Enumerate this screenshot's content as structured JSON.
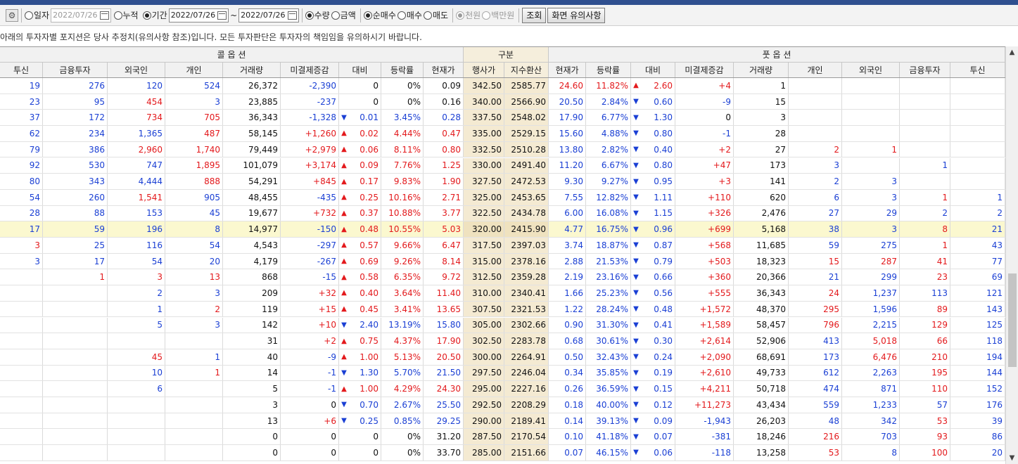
{
  "toolbar": {
    "gear_icon": "gear-icon",
    "daily_label": "일자",
    "daily_date": "2022/07/26",
    "cumulative_label": "누적",
    "period_label": "기간",
    "period_from": "2022/07/26",
    "period_to": "2022/07/26",
    "tilde": "~",
    "quantity_label": "수량",
    "amount_label": "금액",
    "net_buy_label": "순매수",
    "buy_label": "매수",
    "sell_label": "매도",
    "thousand_won_label": "천원",
    "million_won_label": "백만원",
    "query_button": "조회",
    "notes_button": "화면 유의사항"
  },
  "notice": "아래의 투자자별 포지션은 당사 추정치(유의사항 참조)입니다. 모든 투자판단은 투자자의 책임임을 유의하시기 바랍니다.",
  "header_groups": {
    "call": "콜 옵 션",
    "gubun": "구분",
    "put": "풋 옵 션"
  },
  "columns": [
    "투신",
    "금융투자",
    "외국인",
    "개인",
    "거래량",
    "미결제증감",
    "대비",
    "등락률",
    "현재가",
    "행사가",
    "지수환산",
    "현재가",
    "등락률",
    "대비",
    "미결제증감",
    "거래량",
    "개인",
    "외국인",
    "금융투자",
    "투신"
  ],
  "rows": [
    [
      "19",
      "276",
      "120",
      "524",
      "26,372",
      "-2,390",
      "0",
      "0%",
      "0.09",
      "342.50",
      "2585.77",
      "24.60",
      "11.82%",
      "2.60",
      "+4",
      "1",
      "",
      "",
      "",
      ""
    ],
    [
      "23",
      "95",
      "454",
      "3",
      "23,885",
      "-237",
      "0",
      "0%",
      "0.16",
      "340.00",
      "2566.90",
      "20.50",
      "2.84%",
      "0.60",
      "-9",
      "15",
      "",
      "",
      "",
      ""
    ],
    [
      "37",
      "172",
      "734",
      "705",
      "36,343",
      "-1,328",
      "0.01",
      "3.45%",
      "0.28",
      "337.50",
      "2548.02",
      "17.90",
      "6.77%",
      "1.30",
      "0",
      "3",
      "",
      "",
      "",
      ""
    ],
    [
      "62",
      "234",
      "1,365",
      "487",
      "58,145",
      "+1,260",
      "0.02",
      "4.44%",
      "0.47",
      "335.00",
      "2529.15",
      "15.60",
      "4.88%",
      "0.80",
      "-1",
      "28",
      "",
      "",
      "",
      ""
    ],
    [
      "79",
      "386",
      "2,960",
      "1,740",
      "79,449",
      "+2,979",
      "0.06",
      "8.11%",
      "0.80",
      "332.50",
      "2510.28",
      "13.80",
      "2.82%",
      "0.40",
      "+2",
      "27",
      "2",
      "1",
      "",
      ""
    ],
    [
      "92",
      "530",
      "747",
      "1,895",
      "101,079",
      "+3,174",
      "0.09",
      "7.76%",
      "1.25",
      "330.00",
      "2491.40",
      "11.20",
      "6.67%",
      "0.80",
      "+47",
      "173",
      "3",
      "",
      "1",
      ""
    ],
    [
      "80",
      "343",
      "4,444",
      "888",
      "54,291",
      "+845",
      "0.17",
      "9.83%",
      "1.90",
      "327.50",
      "2472.53",
      "9.30",
      "9.27%",
      "0.95",
      "+3",
      "141",
      "2",
      "3",
      "",
      ""
    ],
    [
      "54",
      "260",
      "1,541",
      "905",
      "48,455",
      "-435",
      "0.25",
      "10.16%",
      "2.71",
      "325.00",
      "2453.65",
      "7.55",
      "12.82%",
      "1.11",
      "+110",
      "620",
      "6",
      "3",
      "1",
      "1"
    ],
    [
      "28",
      "88",
      "153",
      "45",
      "19,677",
      "+732",
      "0.37",
      "10.88%",
      "3.77",
      "322.50",
      "2434.78",
      "6.00",
      "16.08%",
      "1.15",
      "+326",
      "2,476",
      "27",
      "29",
      "2",
      "2"
    ],
    [
      "17",
      "59",
      "196",
      "8",
      "14,977",
      "-150",
      "0.48",
      "10.55%",
      "5.03",
      "320.00",
      "2415.90",
      "4.77",
      "16.75%",
      "0.96",
      "+699",
      "5,168",
      "38",
      "3",
      "8",
      "21"
    ],
    [
      "3",
      "25",
      "116",
      "54",
      "4,543",
      "-297",
      "0.57",
      "9.66%",
      "6.47",
      "317.50",
      "2397.03",
      "3.74",
      "18.87%",
      "0.87",
      "+568",
      "11,685",
      "59",
      "275",
      "1",
      "43"
    ],
    [
      "3",
      "17",
      "54",
      "20",
      "4,179",
      "-267",
      "0.69",
      "9.26%",
      "8.14",
      "315.00",
      "2378.16",
      "2.88",
      "21.53%",
      "0.79",
      "+503",
      "18,323",
      "15",
      "287",
      "41",
      "77"
    ],
    [
      "",
      "1",
      "3",
      "13",
      "868",
      "-15",
      "0.58",
      "6.35%",
      "9.72",
      "312.50",
      "2359.28",
      "2.19",
      "23.16%",
      "0.66",
      "+360",
      "20,366",
      "21",
      "299",
      "23",
      "69"
    ],
    [
      "",
      "",
      "2",
      "3",
      "209",
      "+32",
      "0.40",
      "3.64%",
      "11.40",
      "310.00",
      "2340.41",
      "1.66",
      "25.23%",
      "0.56",
      "+555",
      "36,343",
      "24",
      "1,237",
      "113",
      "121"
    ],
    [
      "",
      "",
      "1",
      "2",
      "119",
      "+15",
      "0.45",
      "3.41%",
      "13.65",
      "307.50",
      "2321.53",
      "1.22",
      "28.24%",
      "0.48",
      "+1,572",
      "48,370",
      "295",
      "1,596",
      "89",
      "143"
    ],
    [
      "",
      "",
      "5",
      "3",
      "142",
      "+10",
      "2.40",
      "13.19%",
      "15.80",
      "305.00",
      "2302.66",
      "0.90",
      "31.30%",
      "0.41",
      "+1,589",
      "58,457",
      "796",
      "2,215",
      "129",
      "125"
    ],
    [
      "",
      "",
      "",
      "",
      "31",
      "+2",
      "0.75",
      "4.37%",
      "17.90",
      "302.50",
      "2283.78",
      "0.68",
      "30.61%",
      "0.30",
      "+2,614",
      "52,906",
      "413",
      "5,018",
      "66",
      "118"
    ],
    [
      "",
      "",
      "45",
      "1",
      "40",
      "-9",
      "1.00",
      "5.13%",
      "20.50",
      "300.00",
      "2264.91",
      "0.50",
      "32.43%",
      "0.24",
      "+2,090",
      "68,691",
      "173",
      "6,476",
      "210",
      "194"
    ],
    [
      "",
      "",
      "10",
      "1",
      "14",
      "-1",
      "1.30",
      "5.70%",
      "21.50",
      "297.50",
      "2246.04",
      "0.34",
      "35.85%",
      "0.19",
      "+2,610",
      "49,733",
      "612",
      "2,263",
      "195",
      "144"
    ],
    [
      "",
      "",
      "6",
      "",
      "5",
      "-1",
      "1.00",
      "4.29%",
      "24.30",
      "295.00",
      "2227.16",
      "0.26",
      "36.59%",
      "0.15",
      "+4,211",
      "50,718",
      "474",
      "871",
      "110",
      "152"
    ],
    [
      "",
      "",
      "",
      "",
      "3",
      "0",
      "0.70",
      "2.67%",
      "25.50",
      "292.50",
      "2208.29",
      "0.18",
      "40.00%",
      "0.12",
      "+11,273",
      "43,434",
      "559",
      "1,233",
      "57",
      "176"
    ],
    [
      "",
      "",
      "",
      "",
      "13",
      "+6",
      "0.25",
      "0.85%",
      "29.25",
      "290.00",
      "2189.41",
      "0.14",
      "39.13%",
      "0.09",
      "-1,943",
      "26,203",
      "48",
      "342",
      "53",
      "39"
    ],
    [
      "",
      "",
      "",
      "",
      "0",
      "0",
      "0",
      "0%",
      "31.20",
      "287.50",
      "2170.54",
      "0.10",
      "41.18%",
      "0.07",
      "-381",
      "18,246",
      "216",
      "703",
      "93",
      "86"
    ],
    [
      "",
      "",
      "",
      "",
      "0",
      "0",
      "0",
      "0%",
      "33.70",
      "285.00",
      "2151.66",
      "0.07",
      "46.15%",
      "0.06",
      "-118",
      "13,258",
      "53",
      "8",
      "100",
      "20"
    ]
  ],
  "arrows": {
    "call": [
      "",
      "",
      "down",
      "up",
      "up",
      "up",
      "up",
      "up",
      "up",
      "up",
      "up",
      "up",
      "up",
      "up",
      "up",
      "down",
      "up",
      "up",
      "down",
      "up",
      "down",
      "down",
      "",
      ""
    ],
    "put": [
      "up",
      "down",
      "down",
      "down",
      "down",
      "down",
      "down",
      "down",
      "down",
      "down",
      "down",
      "down",
      "down",
      "down",
      "down",
      "down",
      "down",
      "down",
      "down",
      "down",
      "down",
      "down",
      "down",
      "down"
    ]
  },
  "colors": {
    "call_investor": [
      [
        "blue",
        "blue",
        "blue",
        "blue"
      ],
      [
        "blue",
        "blue",
        "red",
        "blue"
      ],
      [
        "blue",
        "blue",
        "red",
        "red"
      ],
      [
        "blue",
        "blue",
        "blue",
        "red"
      ],
      [
        "blue",
        "blue",
        "red",
        "red"
      ],
      [
        "blue",
        "blue",
        "blue",
        "red"
      ],
      [
        "blue",
        "blue",
        "blue",
        "red"
      ],
      [
        "blue",
        "blue",
        "red",
        "blue"
      ],
      [
        "blue",
        "blue",
        "blue",
        "blue"
      ],
      [
        "blue",
        "blue",
        "blue",
        "blue"
      ],
      [
        "red",
        "blue",
        "blue",
        "blue"
      ],
      [
        "blue",
        "blue",
        "blue",
        "blue"
      ],
      [
        "",
        "red",
        "red",
        "red"
      ],
      [
        "",
        "",
        "blue",
        "blue"
      ],
      [
        "",
        "",
        "blue",
        "red"
      ],
      [
        "",
        "",
        "blue",
        "blue"
      ],
      [
        "",
        "",
        "",
        ""
      ],
      [
        "",
        "",
        "red",
        "blue"
      ],
      [
        "",
        "",
        "blue",
        "red"
      ],
      [
        "",
        "",
        "blue",
        ""
      ],
      [
        "",
        "",
        "",
        ""
      ],
      [
        "",
        "",
        "",
        ""
      ],
      [
        "",
        "",
        "",
        ""
      ],
      [
        "",
        "",
        "",
        ""
      ]
    ],
    "put_investor": [
      [
        "",
        "",
        "",
        ""
      ],
      [
        "",
        "",
        "",
        ""
      ],
      [
        "",
        "",
        "",
        ""
      ],
      [
        "",
        "",
        "",
        ""
      ],
      [
        "red",
        "red",
        "",
        ""
      ],
      [
        "blue",
        "",
        "blue",
        ""
      ],
      [
        "blue",
        "blue",
        "",
        ""
      ],
      [
        "blue",
        "blue",
        "red",
        "blue"
      ],
      [
        "blue",
        "blue",
        "blue",
        "blue"
      ],
      [
        "blue",
        "blue",
        "red",
        "blue"
      ],
      [
        "blue",
        "blue",
        "red",
        "blue"
      ],
      [
        "red",
        "red",
        "red",
        "blue"
      ],
      [
        "blue",
        "blue",
        "red",
        "blue"
      ],
      [
        "red",
        "blue",
        "blue",
        "blue"
      ],
      [
        "red",
        "blue",
        "red",
        "blue"
      ],
      [
        "red",
        "blue",
        "red",
        "blue"
      ],
      [
        "blue",
        "red",
        "red",
        "blue"
      ],
      [
        "blue",
        "red",
        "red",
        "blue"
      ],
      [
        "blue",
        "blue",
        "red",
        "blue"
      ],
      [
        "blue",
        "blue",
        "red",
        "blue"
      ],
      [
        "blue",
        "blue",
        "blue",
        "blue"
      ],
      [
        "blue",
        "blue",
        "red",
        "blue"
      ],
      [
        "red",
        "blue",
        "red",
        "blue"
      ],
      [
        "red",
        "blue",
        "red",
        "blue"
      ]
    ]
  },
  "highlight_row": 9,
  "accent": "#2f4f8f",
  "scroll": {
    "up_icon": "scroll-up-icon",
    "down_icon": "scroll-down-icon"
  }
}
